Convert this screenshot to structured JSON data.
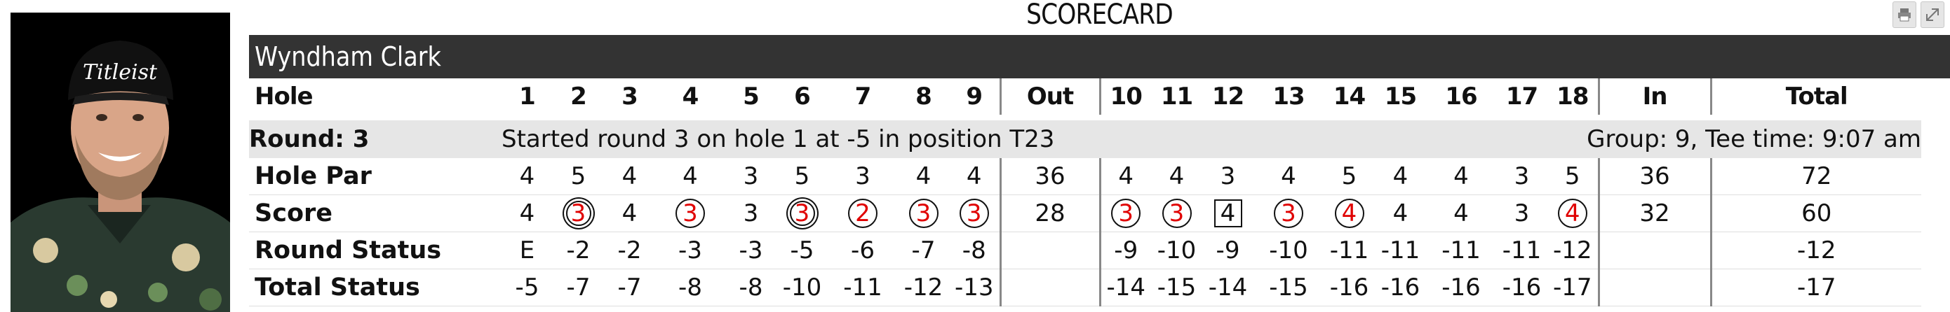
{
  "page_title": "SCORECARD",
  "player": {
    "name": "Wyndham Clark",
    "cap_logo": "Titleist"
  },
  "toolbar": {
    "print_icon": "printer-icon",
    "expand_icon": "expand-icon"
  },
  "hole_header": {
    "label": "Hole",
    "front": [
      "1",
      "2",
      "3",
      "4",
      "5",
      "6",
      "7",
      "8",
      "9"
    ],
    "out": "Out",
    "back": [
      "10",
      "11",
      "12",
      "13",
      "14",
      "15",
      "16",
      "17",
      "18"
    ],
    "in": "In",
    "total": "Total"
  },
  "round_info": {
    "round": "Round: 3",
    "started": "Started round 3 on hole 1 at -5 in position T23",
    "group": "Group: 9, Tee time: 9:07 am"
  },
  "rows": [
    {
      "label": "Hole Par",
      "front": [
        "4",
        "5",
        "4",
        "4",
        "3",
        "5",
        "3",
        "4",
        "4"
      ],
      "out": "36",
      "back": [
        "4",
        "4",
        "3",
        "4",
        "5",
        "4",
        "4",
        "3",
        "5"
      ],
      "in": "36",
      "total": "72"
    },
    {
      "label": "Score",
      "front": [
        "4",
        "3",
        "4",
        "3",
        "3",
        "3",
        "2",
        "3",
        "3"
      ],
      "out": "28",
      "back": [
        "3",
        "3",
        "4",
        "3",
        "4",
        "4",
        "4",
        "3",
        "4"
      ],
      "in": "32",
      "total": "60",
      "front_marks": [
        "par",
        "eagle",
        "par",
        "birdie",
        "par",
        "eagle",
        "birdie",
        "birdie",
        "birdie"
      ],
      "back_marks": [
        "birdie",
        "birdie",
        "bogey",
        "birdie",
        "birdie",
        "par",
        "par",
        "par",
        "birdie"
      ]
    },
    {
      "label": "Round Status",
      "front": [
        "E",
        "-2",
        "-2",
        "-3",
        "-3",
        "-5",
        "-6",
        "-7",
        "-8"
      ],
      "out": "",
      "back": [
        "-9",
        "-10",
        "-9",
        "-10",
        "-11",
        "-11",
        "-11",
        "-11",
        "-12"
      ],
      "in": "",
      "total": "-12"
    },
    {
      "label": "Total Status",
      "front": [
        "-5",
        "-7",
        "-7",
        "-8",
        "-8",
        "-10",
        "-11",
        "-12",
        "-13"
      ],
      "out": "",
      "back": [
        "-14",
        "-15",
        "-14",
        "-15",
        "-16",
        "-16",
        "-16",
        "-16",
        "-17"
      ],
      "in": "",
      "total": "-17"
    }
  ],
  "colors": {
    "name_bar": "#333333",
    "round_bar": "#e6e6e6",
    "under_par": "#e00000"
  }
}
